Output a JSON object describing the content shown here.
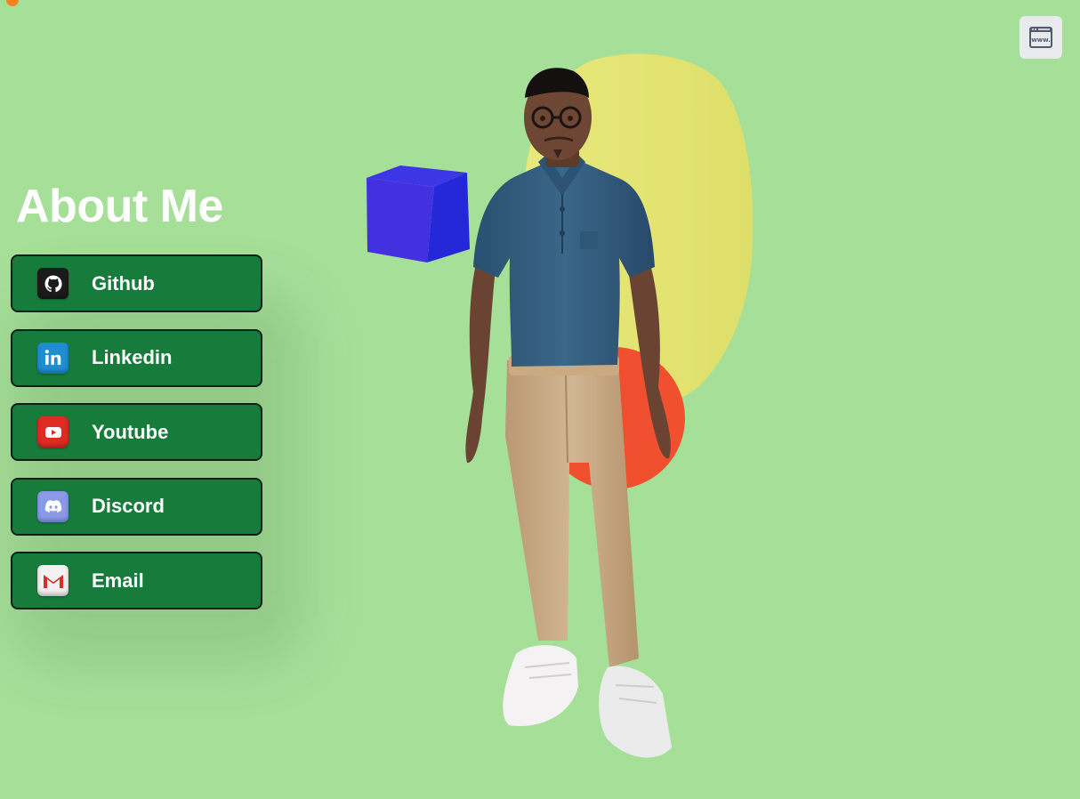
{
  "header": {
    "title": "About Me",
    "window_button_icon": "browser-window-www-icon"
  },
  "links": [
    {
      "label": "Github",
      "icon": "github-icon",
      "color": "#1b1b1b"
    },
    {
      "label": "Linkedin",
      "icon": "linkedin-icon",
      "color": "#1e8ed1"
    },
    {
      "label": "Youtube",
      "icon": "youtube-icon",
      "color": "#e02b24"
    },
    {
      "label": "Discord",
      "icon": "discord-icon",
      "color": "#8b9ae8"
    },
    {
      "label": "Email",
      "icon": "gmail-icon",
      "color": "#f2f2f2"
    }
  ],
  "scene": {
    "avatar": "3d-avatar",
    "shapes": [
      "blue-cube",
      "yellow-blob",
      "red-circle"
    ]
  },
  "colors": {
    "background": "#a5df98",
    "button": "#177c3b",
    "button_border": "#0f1f17",
    "title": "#ffffff",
    "accent_dot": "#f5821f"
  }
}
